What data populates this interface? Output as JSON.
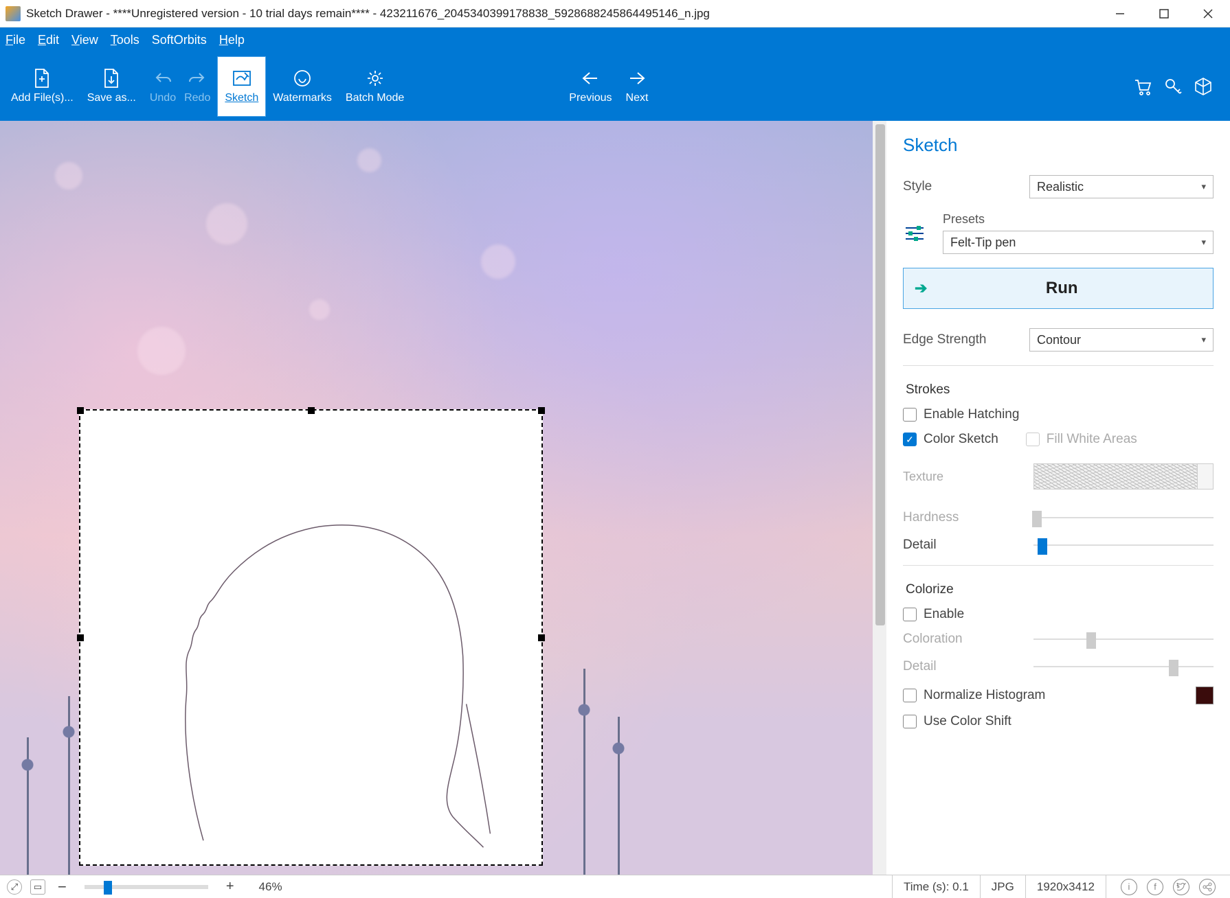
{
  "title": "Sketch Drawer - ****Unregistered version - 10 trial days remain**** - 423211676_2045340399178838_5928688245864495146_n.jpg",
  "menu": {
    "file": "File",
    "edit": "Edit",
    "view": "View",
    "tools": "Tools",
    "softorbits": "SoftOrbits",
    "help": "Help"
  },
  "toolbar": {
    "addfiles": "Add File(s)...",
    "saveas": "Save as...",
    "undo": "Undo",
    "redo": "Redo",
    "sketch": "Sketch",
    "watermarks": "Watermarks",
    "batch": "Batch Mode",
    "previous": "Previous",
    "next": "Next"
  },
  "panel": {
    "title": "Sketch",
    "style_label": "Style",
    "style_value": "Realistic",
    "presets_label": "Presets",
    "presets_value": "Felt-Tip pen",
    "run": "Run",
    "edge_label": "Edge Strength",
    "edge_value": "Contour",
    "strokes": {
      "title": "Strokes",
      "enable_hatching": "Enable Hatching",
      "color_sketch": "Color Sketch",
      "fill_white": "Fill White Areas",
      "texture": "Texture",
      "hardness": "Hardness",
      "detail": "Detail"
    },
    "colorize": {
      "title": "Colorize",
      "enable": "Enable",
      "coloration": "Coloration",
      "detail": "Detail",
      "normalize": "Normalize Histogram",
      "color_shift": "Use Color Shift"
    },
    "sliders": {
      "hardness_pct": 2,
      "detail_pct": 5,
      "coloration_pct": 32,
      "colorize_detail_pct": 78
    }
  },
  "status": {
    "zoom_pct": "46%",
    "time": "Time (s): 0.1",
    "format": "JPG",
    "dims": "1920x3412"
  }
}
